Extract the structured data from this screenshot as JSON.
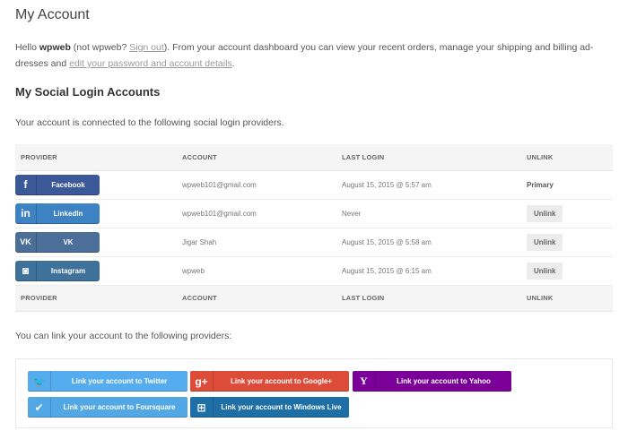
{
  "page": {
    "title": "My Account",
    "intro": {
      "hello": "Hello ",
      "username": "wpweb",
      "not_text": " (not wpweb? ",
      "sign_out": "Sign out",
      "after_sign_out": "). From your account dashboard you can view your recent orders, manage your shipping and billing ad-dresses and ",
      "edit_link": "edit your password and account details",
      "end": "."
    }
  },
  "social": {
    "section_title": "My Social Login Accounts",
    "connected_text": "Your account is connected to the following social login providers.",
    "headers": [
      "PROVIDER",
      "ACCOUNT",
      "LAST LOGIN",
      "UNLINK"
    ],
    "rows": [
      {
        "provider": "Facebook",
        "icon": "f",
        "account": "wpweb101@gmail.com",
        "last_login": "August 15, 2015 @ 5:57 am",
        "unlink": "Primary"
      },
      {
        "provider": "LinkedIn",
        "icon": "in",
        "account": "wpweb101@gmail.com",
        "last_login": "Never",
        "unlink": "Unlink"
      },
      {
        "provider": "VK",
        "icon": "VK",
        "account": "Jigar Shah",
        "last_login": "August 15, 2015 @ 5:58 am",
        "unlink": "Unlink"
      },
      {
        "provider": "Instagram",
        "icon": "◙",
        "account": "wpweb",
        "last_login": "August 15, 2015 @ 6:15 am",
        "unlink": "Unlink"
      }
    ]
  },
  "link": {
    "text": "You can link your account to the following providers:",
    "buttons": [
      {
        "label": "Link your account to Twitter",
        "icon": "🐦"
      },
      {
        "label": "Link your account to Google+",
        "icon": "g+"
      },
      {
        "label": "Link your account to Yahoo",
        "icon": "Y"
      },
      {
        "label": "Link your account to Foursquare",
        "icon": "✔"
      },
      {
        "label": "Link your account to Windows Live",
        "icon": "⊞"
      }
    ]
  },
  "colors": {
    "facebook": "#3b5998",
    "linkedin": "#3d82c2",
    "vk": "#4b6f98",
    "instagram": "#3f729b",
    "twitter": "#55acee",
    "googleplus": "#dd4b39",
    "yahoo": "#7b0099",
    "foursquare": "#52a7e5",
    "windowslive": "#1e6fa6"
  }
}
